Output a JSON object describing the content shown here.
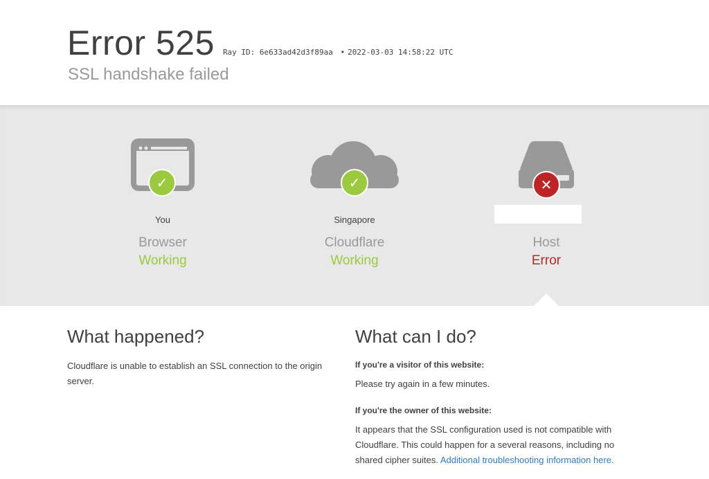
{
  "header": {
    "code": "Error 525",
    "ray_label": "Ray ID:",
    "ray_id": "6e633ad42d3f89aa",
    "separator": "•",
    "timestamp": "2022-03-03 14:58:22 UTC",
    "subtitle": "SSL handshake failed"
  },
  "nodes": [
    {
      "location": "You",
      "name": "Browser",
      "status": "Working",
      "state": "ok",
      "icon": "browser-window-icon"
    },
    {
      "location": "Singapore",
      "name": "Cloudflare",
      "status": "Working",
      "state": "ok",
      "icon": "cloud-icon"
    },
    {
      "location": "",
      "name": "Host",
      "status": "Error",
      "state": "error",
      "icon": "server-drive-icon"
    }
  ],
  "colors": {
    "ok": "#9bca3e",
    "error": "#bd2426",
    "icon_gray": "#999999",
    "band": "#e8e8e8"
  },
  "what_happened": {
    "title": "What happened?",
    "body": "Cloudflare is unable to establish an SSL connection to the origin server."
  },
  "what_can_i_do": {
    "title": "What can I do?",
    "visitor_heading": "If you're a visitor of this website:",
    "visitor_body": "Please try again in a few minutes.",
    "owner_heading": "If you're the owner of this website:",
    "owner_body": "It appears that the SSL configuration used is not compatible with Cloudflare. This could happen for a several reasons, including no shared cipher suites.",
    "owner_link": "Additional troubleshooting information here."
  }
}
